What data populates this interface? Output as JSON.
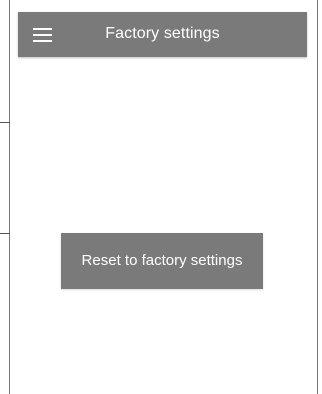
{
  "toolbar": {
    "title": "Factory settings",
    "menu_icon": "hamburger-menu-icon"
  },
  "main": {
    "reset_button_label": "Reset to factory settings"
  },
  "colors": {
    "toolbar_background": "#7a7a7a",
    "button_background": "#7a7a7a",
    "text_on_accent": "#ffffff",
    "page_background": "#ffffff"
  }
}
